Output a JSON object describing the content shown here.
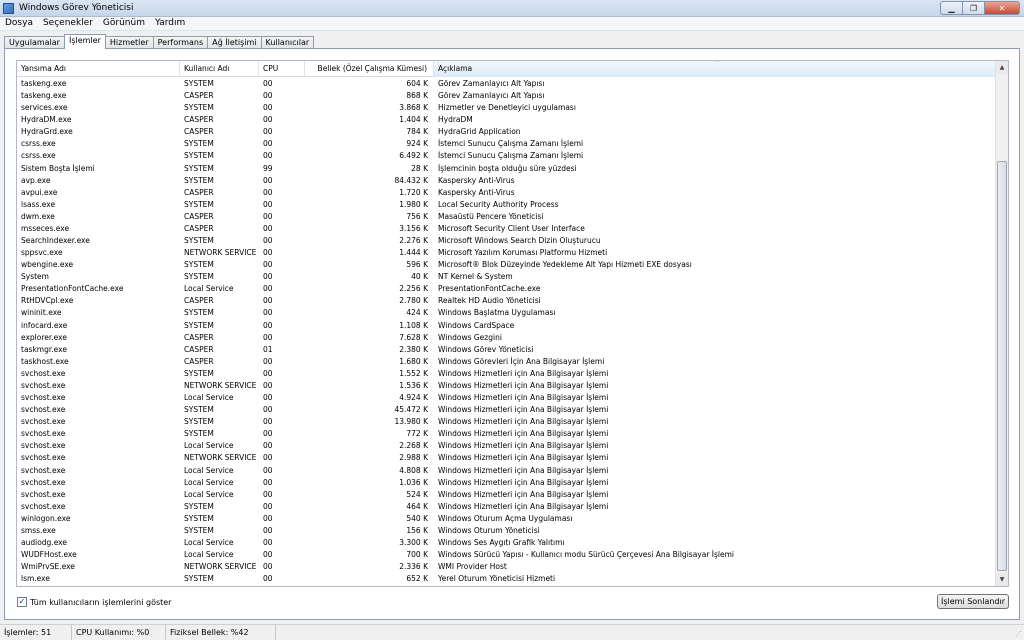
{
  "window": {
    "title": "Windows Görev Yöneticisi",
    "min_glyph": "▁",
    "max_glyph": "❐",
    "close_glyph": "✕"
  },
  "menu": [
    "Dosya",
    "Seçenekler",
    "Görünüm",
    "Yardım"
  ],
  "tabs": [
    "Uygulamalar",
    "İşlemler",
    "Hizmetler",
    "Performans",
    "Ağ İletişimi",
    "Kullanıcılar"
  ],
  "active_tab": 1,
  "columns": [
    "Yansıma Adı",
    "Kullanıcı Adı",
    "CPU",
    "Bellek (Özel Çalışma Kümesi)",
    "Açıklama"
  ],
  "sort_glyph": "^",
  "processes": [
    [
      "taskeng.exe",
      "SYSTEM",
      "00",
      "604 K",
      "Görev Zamanlayıcı Alt Yapısı"
    ],
    [
      "taskeng.exe",
      "CASPER",
      "00",
      "868 K",
      "Görev Zamanlayıcı Alt Yapısı"
    ],
    [
      "services.exe",
      "SYSTEM",
      "00",
      "3.868 K",
      "Hizmetler ve Denetleyici uygulaması"
    ],
    [
      "HydraDM.exe",
      "CASPER",
      "00",
      "1.404 K",
      "HydraDM"
    ],
    [
      "HydraGrd.exe",
      "CASPER",
      "00",
      "784 K",
      "HydraGrid Application"
    ],
    [
      "csrss.exe",
      "SYSTEM",
      "00",
      "924 K",
      "İstemci Sunucu Çalışma Zamanı İşlemi"
    ],
    [
      "csrss.exe",
      "SYSTEM",
      "00",
      "6.492 K",
      "İstemci Sunucu Çalışma Zamanı İşlemi"
    ],
    [
      "Sistem Boşta İşlemi",
      "SYSTEM",
      "99",
      "28 K",
      "İşlemcinin boşta olduğu süre yüzdesi"
    ],
    [
      "avp.exe",
      "SYSTEM",
      "00",
      "84.432 K",
      "Kaspersky Anti-Virus"
    ],
    [
      "avpui.exe",
      "CASPER",
      "00",
      "1.720 K",
      "Kaspersky Anti-Virus"
    ],
    [
      "lsass.exe",
      "SYSTEM",
      "00",
      "1.980 K",
      "Local Security Authority Process"
    ],
    [
      "dwm.exe",
      "CASPER",
      "00",
      "756 K",
      "Masaüstü Pencere Yöneticisi"
    ],
    [
      "msseces.exe",
      "CASPER",
      "00",
      "3.156 K",
      "Microsoft Security Client User Interface"
    ],
    [
      "SearchIndexer.exe",
      "SYSTEM",
      "00",
      "2.276 K",
      "Microsoft Windows Search Dizin Oluşturucu"
    ],
    [
      "sppsvc.exe",
      "NETWORK SERVICE",
      "00",
      "1.444 K",
      "Microsoft Yazılım Koruması Platformu Hizmeti"
    ],
    [
      "wbengine.exe",
      "SYSTEM",
      "00",
      "596 K",
      "Microsoft® Blok Düzeyinde Yedekleme Alt Yapı Hizmeti EXE dosyası"
    ],
    [
      "System",
      "SYSTEM",
      "00",
      "40 K",
      "NT Kernel & System"
    ],
    [
      "PresentationFontCache.exe",
      "Local Service",
      "00",
      "2.256 K",
      "PresentationFontCache.exe"
    ],
    [
      "RtHDVCpl.exe",
      "CASPER",
      "00",
      "2.780 K",
      "Realtek HD Audio Yöneticisi"
    ],
    [
      "wininit.exe",
      "SYSTEM",
      "00",
      "424 K",
      "Windows Başlatma Uygulaması"
    ],
    [
      "infocard.exe",
      "SYSTEM",
      "00",
      "1.108 K",
      "Windows CardSpace"
    ],
    [
      "explorer.exe",
      "CASPER",
      "00",
      "7.628 K",
      "Windows Gezgini"
    ],
    [
      "taskmgr.exe",
      "CASPER",
      "01",
      "2.380 K",
      "Windows Görev Yöneticisi"
    ],
    [
      "taskhost.exe",
      "CASPER",
      "00",
      "1.680 K",
      "Windows Görevleri İçin Ana Bilgisayar İşlemi"
    ],
    [
      "svchost.exe",
      "SYSTEM",
      "00",
      "1.552 K",
      "Windows Hizmetleri için Ana Bilgisayar İşlemi"
    ],
    [
      "svchost.exe",
      "NETWORK SERVICE",
      "00",
      "1.536 K",
      "Windows Hizmetleri için Ana Bilgisayar İşlemi"
    ],
    [
      "svchost.exe",
      "Local Service",
      "00",
      "4.924 K",
      "Windows Hizmetleri için Ana Bilgisayar İşlemi"
    ],
    [
      "svchost.exe",
      "SYSTEM",
      "00",
      "45.472 K",
      "Windows Hizmetleri için Ana Bilgisayar İşlemi"
    ],
    [
      "svchost.exe",
      "SYSTEM",
      "00",
      "13.980 K",
      "Windows Hizmetleri için Ana Bilgisayar İşlemi"
    ],
    [
      "svchost.exe",
      "SYSTEM",
      "00",
      "772 K",
      "Windows Hizmetleri için Ana Bilgisayar İşlemi"
    ],
    [
      "svchost.exe",
      "Local Service",
      "00",
      "2.268 K",
      "Windows Hizmetleri için Ana Bilgisayar İşlemi"
    ],
    [
      "svchost.exe",
      "NETWORK SERVICE",
      "00",
      "2.988 K",
      "Windows Hizmetleri için Ana Bilgisayar İşlemi"
    ],
    [
      "svchost.exe",
      "Local Service",
      "00",
      "4.808 K",
      "Windows Hizmetleri için Ana Bilgisayar İşlemi"
    ],
    [
      "svchost.exe",
      "Local Service",
      "00",
      "1.036 K",
      "Windows Hizmetleri için Ana Bilgisayar İşlemi"
    ],
    [
      "svchost.exe",
      "Local Service",
      "00",
      "524 K",
      "Windows Hizmetleri için Ana Bilgisayar İşlemi"
    ],
    [
      "svchost.exe",
      "SYSTEM",
      "00",
      "464 K",
      "Windows Hizmetleri için Ana Bilgisayar İşlemi"
    ],
    [
      "winlogon.exe",
      "SYSTEM",
      "00",
      "540 K",
      "Windows Oturum Açma Uygulaması"
    ],
    [
      "smss.exe",
      "SYSTEM",
      "00",
      "156 K",
      "Windows Oturum Yöneticisi"
    ],
    [
      "audiodg.exe",
      "Local Service",
      "00",
      "3.300 K",
      "Windows Ses Aygıtı Grafik Yalıtımı"
    ],
    [
      "WUDFHost.exe",
      "Local Service",
      "00",
      "700 K",
      "Windows Sürücü Yapısı - Kullanıcı modu Sürücü Çerçevesi Ana Bilgisayar İşlemi"
    ],
    [
      "WmiPrvSE.exe",
      "NETWORK SERVICE",
      "00",
      "2.336 K",
      "WMI Provider Host"
    ],
    [
      "lsm.exe",
      "SYSTEM",
      "00",
      "652 K",
      "Yerel Oturum Yöneticisi Hizmeti"
    ]
  ],
  "show_all_users": {
    "label": "Tüm kullanıcıların işlemlerini göster",
    "checked": true,
    "check_glyph": "✓"
  },
  "end_process_label": "İşlemi Sonlandır",
  "scroll": {
    "up_glyph": "▲",
    "down_glyph": "▼"
  },
  "status": {
    "processes": "İşlemler: 51",
    "cpu": "CPU Kullanımı: %0",
    "memory": "Fiziksel Bellek: %42"
  }
}
